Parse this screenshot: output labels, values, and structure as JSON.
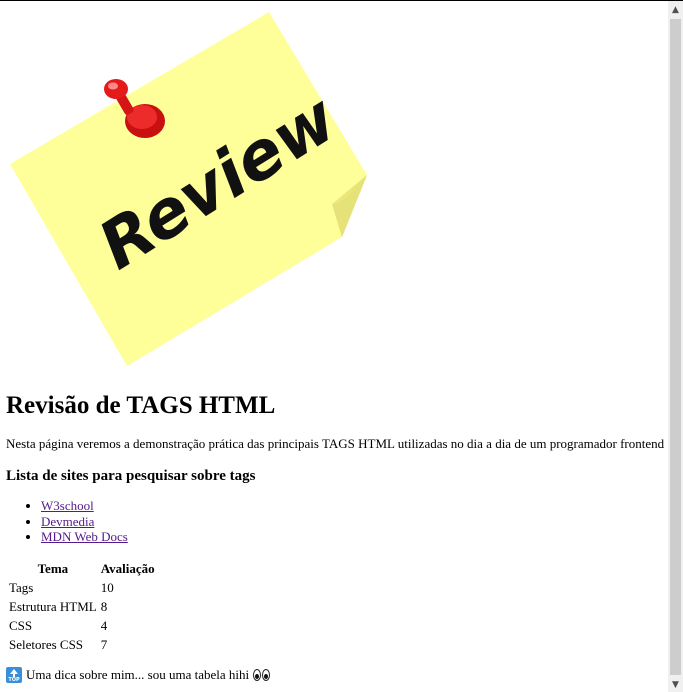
{
  "image": {
    "alt_word": "Review"
  },
  "page": {
    "title": "Revisão de TAGS HTML",
    "intro": "Nesta página veremos a demonstração prática das principais TAGS HTML utilizadas no dia a dia de um programador frontend",
    "list_heading": "Lista de sites para pesquisar sobre tags",
    "links": [
      {
        "label": "W3school"
      },
      {
        "label": "Devmedia"
      },
      {
        "label": "MDN Web Docs"
      }
    ],
    "table": {
      "headers": [
        "Tema",
        "Avaliação"
      ],
      "rows": [
        [
          "Tags",
          "10"
        ],
        [
          "Estrutura HTML",
          "8"
        ],
        [
          "CSS",
          "4"
        ],
        [
          "Seletores CSS",
          "7"
        ]
      ]
    },
    "tip": "Uma dica sobre mim... sou uma tabela hihi",
    "tip_icon_text": "TOP"
  },
  "colors": {
    "note": "#ffff99",
    "pin": "#e31b1b",
    "link_visited": "#551a8b",
    "scrollbar_thumb": "#cdcdcd"
  },
  "icons": [
    "top-arrow-icon",
    "eyes-icon",
    "push-pin-icon"
  ]
}
